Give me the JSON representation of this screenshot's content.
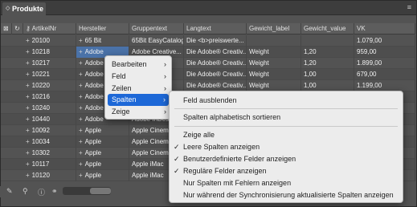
{
  "tab": {
    "label": "Produkte"
  },
  "columns": [
    "ArtikelNr",
    "Hersteller",
    "Gruppentext",
    "Langtext",
    "Gewicht_label",
    "Gewicht_value",
    "VK"
  ],
  "rows": [
    [
      "20100",
      "65 Bit",
      "65Bit EasyCatalog",
      "Die <b>preiswerte...",
      "",
      "",
      "1.079,00"
    ],
    [
      "10218",
      "Adobe",
      "Adobe Creative...",
      "Die Adobe® Creativ...",
      "Weight",
      "1,20",
      "959,00"
    ],
    [
      "10217",
      "Adobe",
      "",
      "Die Adobe® Creativ...",
      "Weight",
      "1,20",
      "1.899,00"
    ],
    [
      "10221",
      "Adobe",
      "",
      "Die Adobe® Creativ...",
      "Weight",
      "1,00",
      "679,00"
    ],
    [
      "10220",
      "Adobe",
      "",
      "Die Adobe® Creativ...",
      "Weight",
      "1,00",
      "1.199,00"
    ],
    [
      "10216",
      "Adobe",
      "",
      "",
      "",
      "",
      ""
    ],
    [
      "10240",
      "Adobe",
      "",
      "",
      "",
      "",
      ""
    ],
    [
      "10440",
      "Adobe",
      "Adobe InDesi...",
      "",
      "",
      "",
      ""
    ],
    [
      "10092",
      "Apple",
      "Apple Cinema",
      "",
      "",
      "",
      ""
    ],
    [
      "10034",
      "Apple",
      "Apple Cinema",
      "",
      "",
      "",
      ""
    ],
    [
      "10302",
      "Apple",
      "Apple Cinema",
      "",
      "",
      "",
      ""
    ],
    [
      "10117",
      "Apple",
      "Apple iMac",
      "",
      "",
      "",
      ""
    ],
    [
      "10120",
      "Apple",
      "Apple iMac",
      "",
      "",
      "",
      ""
    ]
  ],
  "context_menu": {
    "items": [
      {
        "label": "Bearbeiten"
      },
      {
        "label": "Feld"
      },
      {
        "label": "Zeilen"
      },
      {
        "label": "Spalten"
      },
      {
        "label": "Zeige"
      }
    ]
  },
  "submenu": {
    "items": [
      {
        "label": "Feld ausblenden",
        "checked": false
      },
      {
        "label": "Spalten alphabetisch sortieren",
        "checked": false
      },
      {
        "label": "Zeige alle",
        "checked": false
      },
      {
        "label": "Leere Spalten anzeigen",
        "checked": true
      },
      {
        "label": "Benutzerdefinierte Felder anzeigen",
        "checked": true
      },
      {
        "label": "Reguläre Felder anzeigen",
        "checked": true
      },
      {
        "label": "Nur Spalten mit Fehlern anzeigen",
        "checked": false
      },
      {
        "label": "Nur während der Synchronisierung aktualisierte Spalten anzeigen",
        "checked": false
      }
    ]
  },
  "colors": {
    "accent": "#1d68d7",
    "panel": "#535353"
  },
  "icons": [
    "close-icon",
    "panel-menu-icon",
    "select-all-icon",
    "refresh-icon",
    "key-icon",
    "pencil-icon",
    "search-icon",
    "info-icon",
    "link-icon"
  ]
}
